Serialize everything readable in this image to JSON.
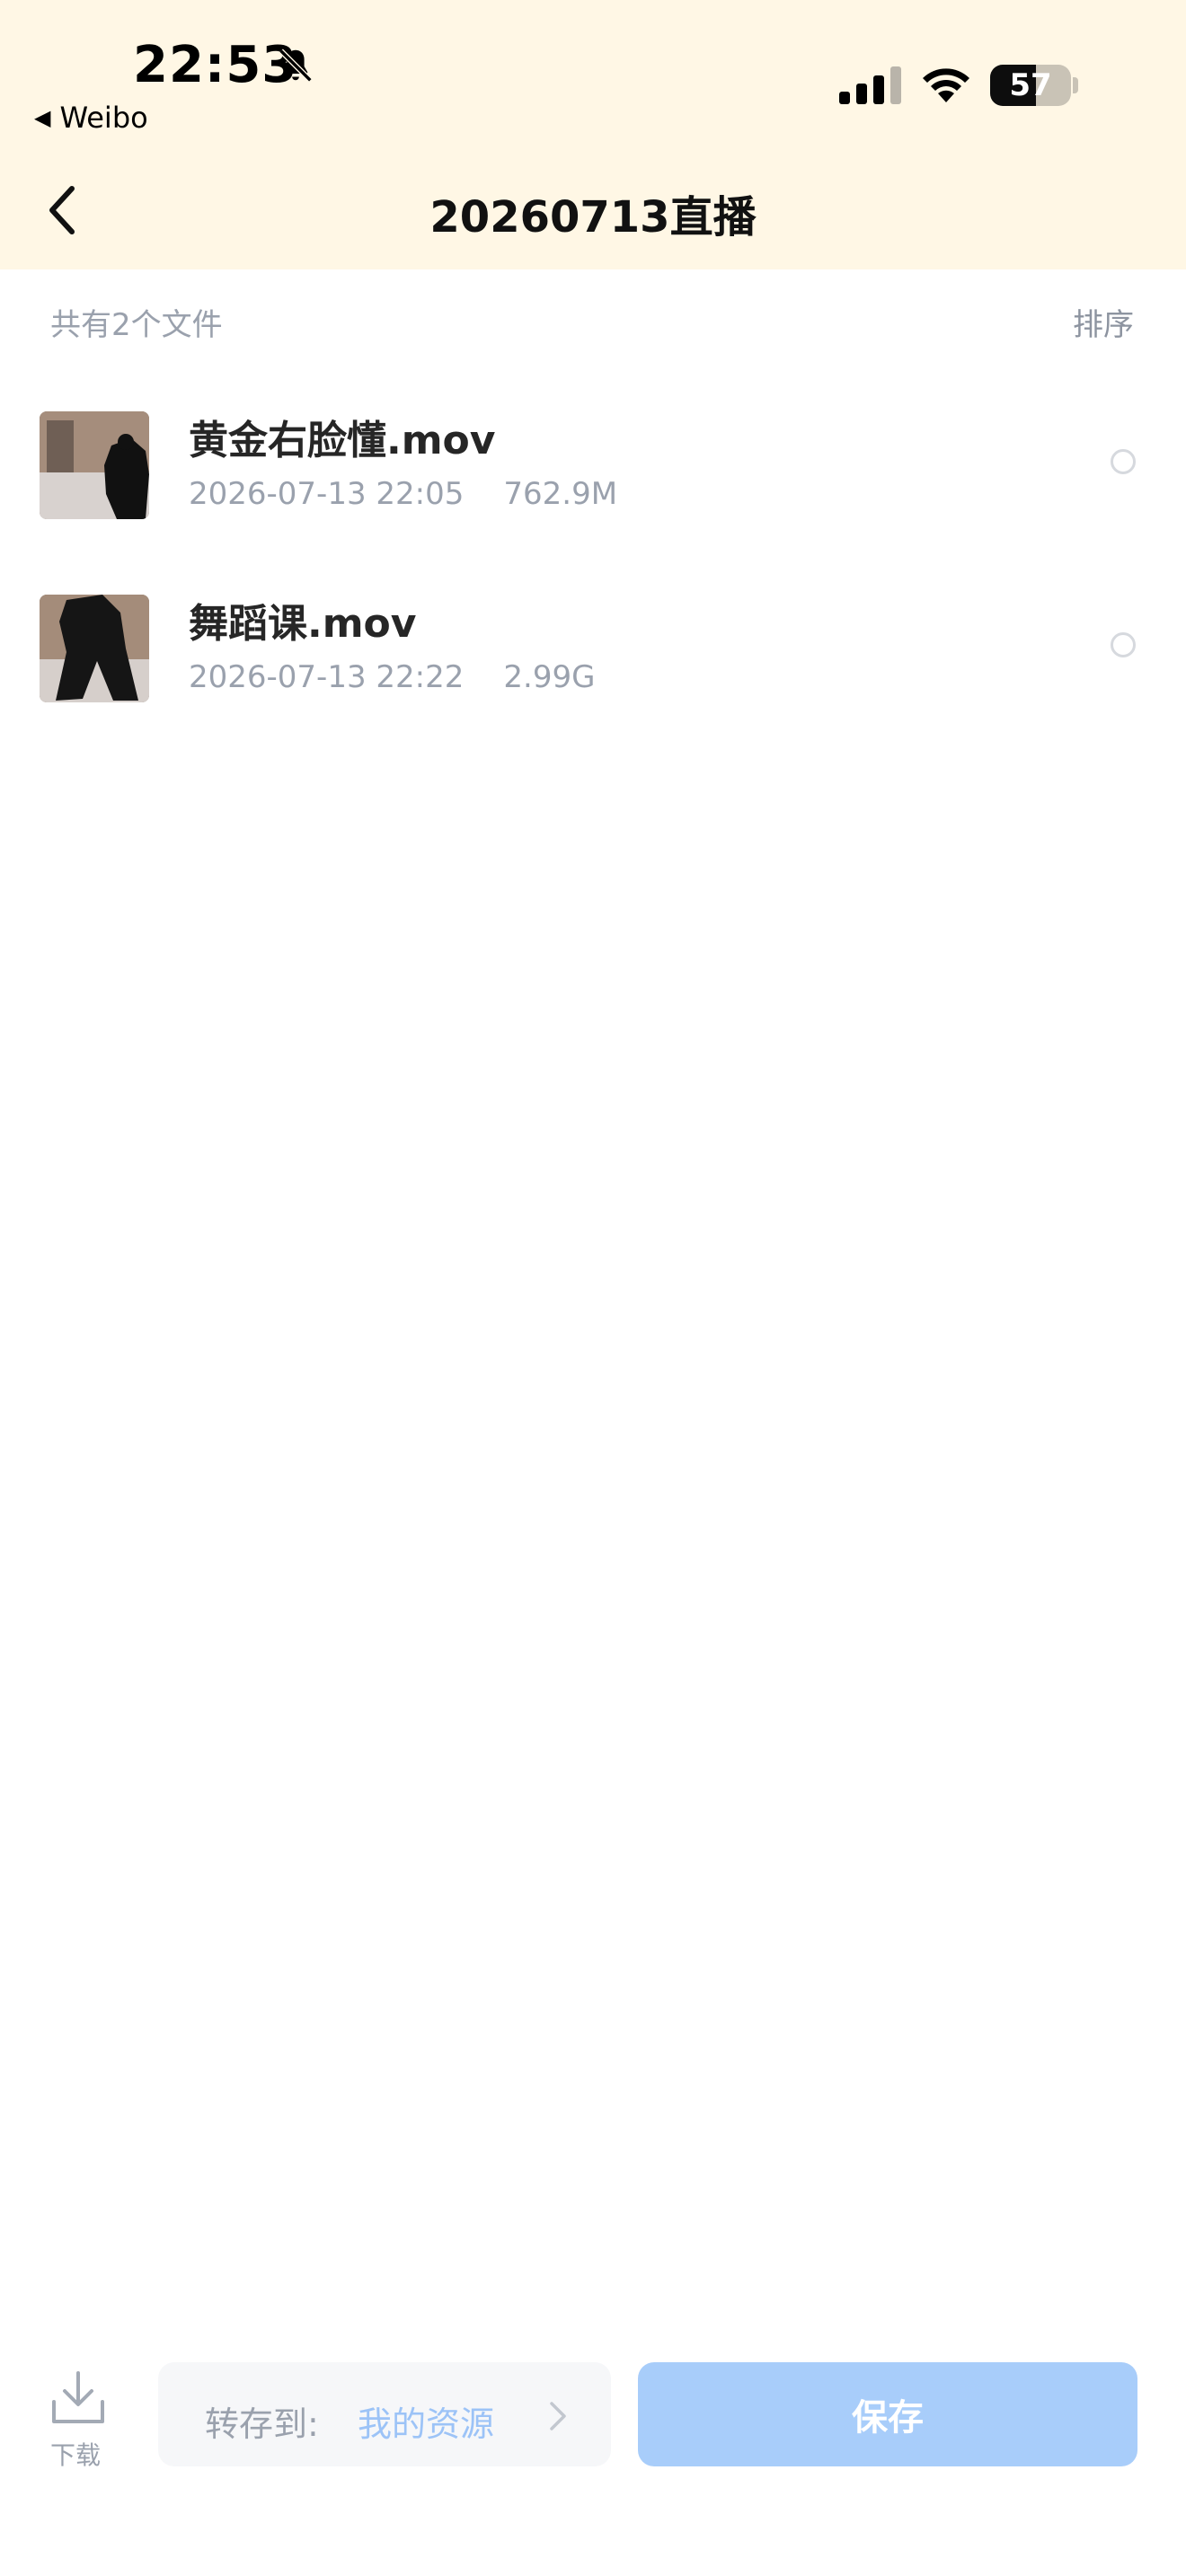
{
  "status_bar": {
    "time": "22:53",
    "back_app": "Weibo",
    "battery": "57",
    "battery_level": 0.57
  },
  "header": {
    "title": "20260713直播"
  },
  "list_header": {
    "count_text": "共有2个文件",
    "sort_label": "排序"
  },
  "files": [
    {
      "name": "黄金右脸懂.mov",
      "date": "2026-07-13 22:05",
      "size": "762.9M"
    },
    {
      "name": "舞蹈课.mov",
      "date": "2026-07-13 22:22",
      "size": "2.99G"
    }
  ],
  "bottom": {
    "download_label": "下载",
    "transfer_label": "转存到:",
    "transfer_target": "我的资源",
    "save_label": "保存"
  },
  "colors": {
    "header_bg": "#fff7e5",
    "accent": "#a8cdfa",
    "link": "#9cc3f7",
    "muted_text": "#9aa1ad"
  },
  "icons": [
    "bell-slash-icon",
    "signal-icon",
    "wifi-icon",
    "battery-icon",
    "back-chevron-icon",
    "radio-icon",
    "download-icon",
    "chevron-right-icon"
  ]
}
